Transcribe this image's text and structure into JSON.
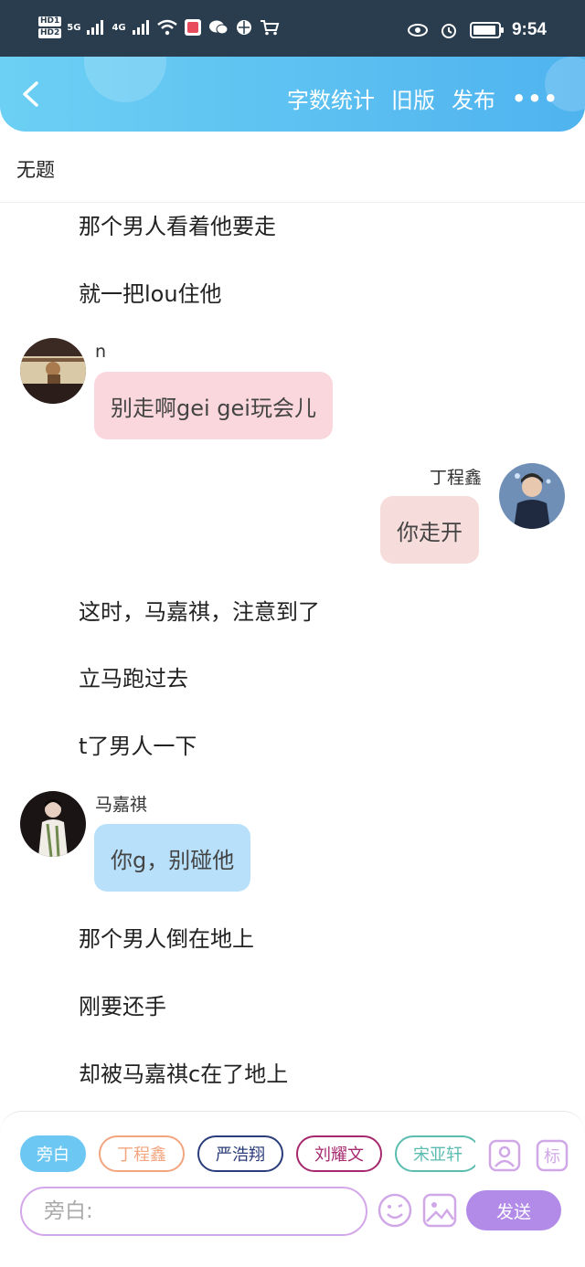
{
  "status_bar": {
    "hd1": "HD1",
    "hd2": "HD2",
    "net1": "5G",
    "net2": "4G",
    "time": "9:54"
  },
  "header": {
    "actions": [
      "字数统计",
      "旧版",
      "发布"
    ],
    "more": "•••"
  },
  "title": "无题",
  "story": {
    "narration": [
      "那个男人看着他要走",
      "就一把lou住他",
      "这时，马嘉祺，注意到了",
      "立马跑过去",
      "t了男人一下",
      "那个男人倒在地上",
      "刚要还手",
      "却被马嘉祺c在了地上"
    ],
    "messages": [
      {
        "name": "n",
        "text": "别走啊gei gei玩会儿"
      },
      {
        "name": "丁程鑫",
        "text": "你走开"
      },
      {
        "name": "马嘉祺",
        "text": "你g，别碰他"
      }
    ]
  },
  "bottom_bar": {
    "roles": [
      "旁白",
      "丁程鑫",
      "严浩翔",
      "刘耀文",
      "宋亚轩"
    ],
    "input_placeholder": "旁白:",
    "send_label": "发送"
  },
  "colors": {
    "header_start": "#6cd0f4",
    "header_end": "#4fb3ef",
    "status_bg": "#293d4f",
    "send_button": "#b28ae8",
    "bubble_pink": "#fad7dd",
    "bubble_beige": "#f6dddc",
    "bubble_blue": "#b8e0fb"
  }
}
